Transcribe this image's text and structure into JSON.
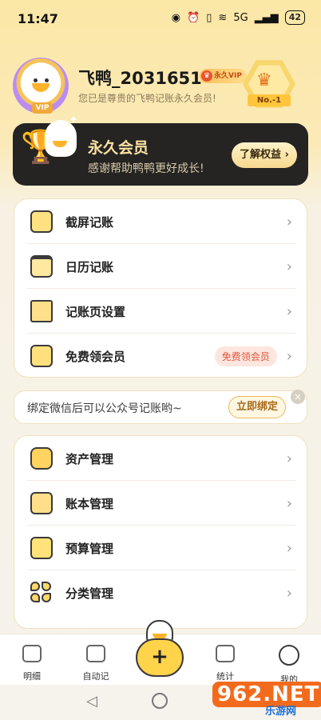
{
  "status_bar": {
    "time": "11:47",
    "signal_label": "5G",
    "battery": "42"
  },
  "profile": {
    "username": "飞鸭_2031651",
    "vip_badge": "永久VIP",
    "subtitle": "您已是尊贵的飞鸭记账永久会员!",
    "avatar_tag": "VIP",
    "rank_label": "No.-1"
  },
  "banner": {
    "title": "永久会员",
    "subtitle": "感谢帮助鸭鸭更好成长!",
    "button_label": "了解权益 ›"
  },
  "menu_group_1": [
    {
      "label": "截屏记账",
      "icon": "screenshot-icon"
    },
    {
      "label": "日历记账",
      "icon": "calendar-icon"
    },
    {
      "label": "记账页设置",
      "icon": "settings-doc-icon"
    },
    {
      "label": "免费领会员",
      "icon": "gift-icon",
      "tag": "免费领会员"
    }
  ],
  "notify": {
    "text": "绑定微信后可以公众号记账哟~",
    "button_label": "立即绑定",
    "close": "×"
  },
  "menu_group_2": [
    {
      "label": "资产管理",
      "icon": "wallet-icon"
    },
    {
      "label": "账本管理",
      "icon": "book-icon"
    },
    {
      "label": "预算管理",
      "icon": "calculator-icon"
    },
    {
      "label": "分类管理",
      "icon": "category-icon"
    }
  ],
  "bottom_nav": [
    {
      "label": "明细",
      "icon": "details-icon"
    },
    {
      "label": "自动记",
      "icon": "auto-record-icon"
    },
    {
      "label": "统计",
      "icon": "stats-icon"
    },
    {
      "label": "我的",
      "icon": "profile-icon"
    }
  ],
  "add_button": "+",
  "watermark": {
    "logo": "962.NET",
    "sub": "乐游网"
  },
  "colors": {
    "accent_yellow": "#ffd34a",
    "banner_dark": "#252423",
    "vip_orange": "#e8552f",
    "free_tag_red": "#e4553b"
  }
}
